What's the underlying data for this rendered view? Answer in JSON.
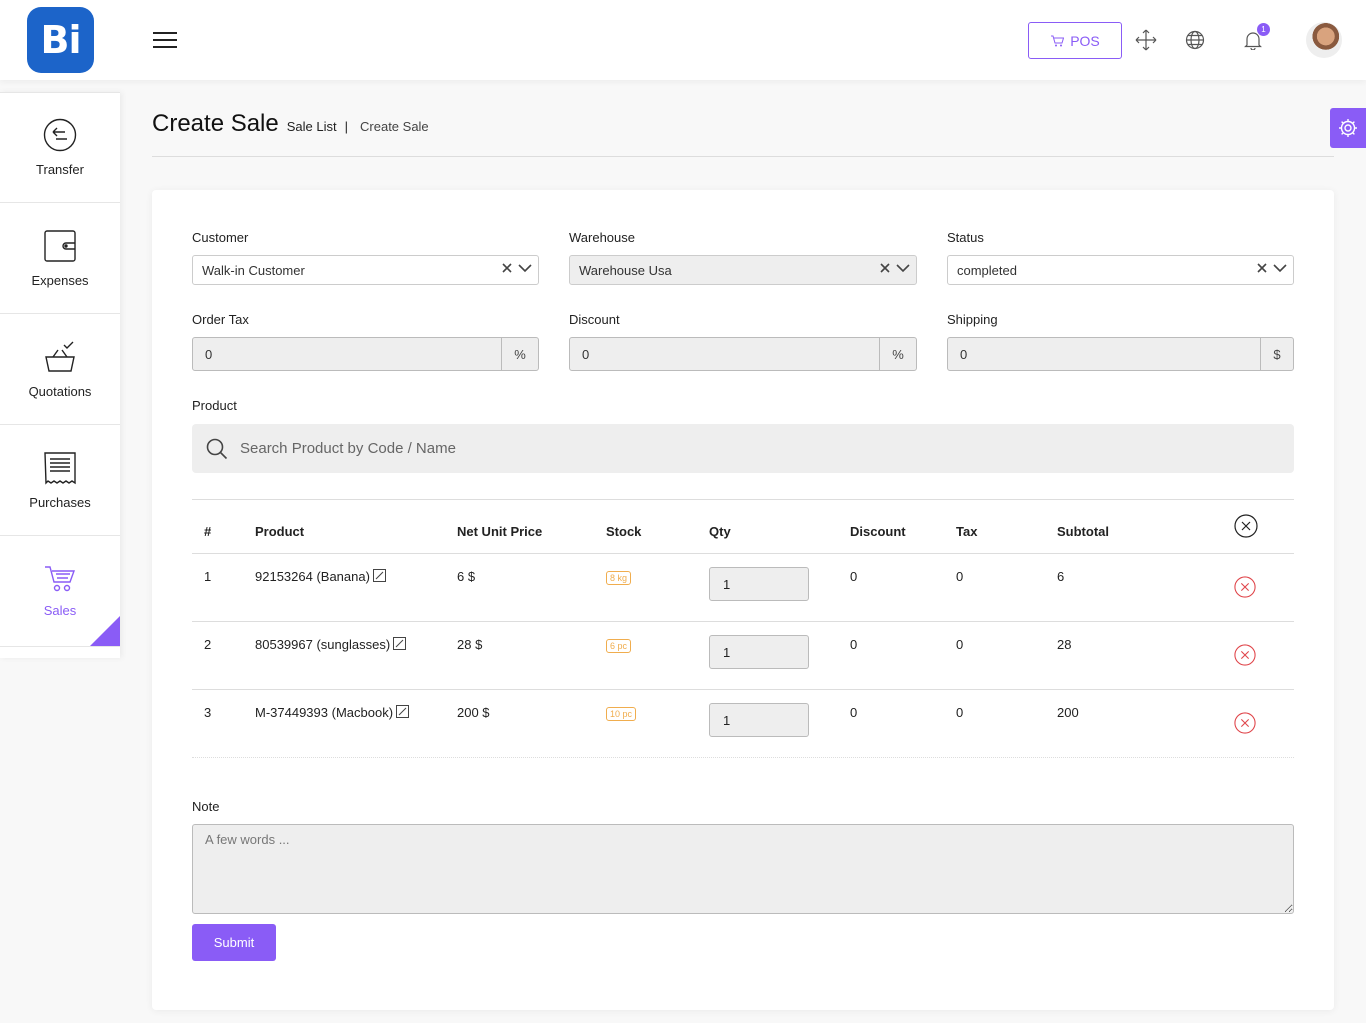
{
  "brand": {
    "logo_text": "Bi",
    "accent_color": "#8a5cf6",
    "logo_color": "#1c64c9"
  },
  "header": {
    "pos_label": "POS",
    "notification_count": "1",
    "icons": [
      "menu-icon",
      "cart-icon",
      "fullscreen-icon",
      "globe-icon",
      "bell-icon",
      "avatar"
    ]
  },
  "sidebar": {
    "items": [
      {
        "label": "Transfer",
        "icon": "transfer-icon"
      },
      {
        "label": "Expenses",
        "icon": "wallet-icon"
      },
      {
        "label": "Quotations",
        "icon": "basket-icon"
      },
      {
        "label": "Purchases",
        "icon": "receipt-icon"
      },
      {
        "label": "Sales",
        "icon": "cart-icon",
        "active": true
      }
    ]
  },
  "page": {
    "title": "Create Sale",
    "breadcrumb": [
      "Sale List",
      "|",
      "Create Sale"
    ]
  },
  "form": {
    "customer": {
      "label": "Customer",
      "value": "Walk-in Customer"
    },
    "warehouse": {
      "label": "Warehouse",
      "value": "Warehouse Usa"
    },
    "status": {
      "label": "Status",
      "value": "completed"
    },
    "order_tax": {
      "label": "Order Tax",
      "value": "0",
      "addon": "%"
    },
    "discount": {
      "label": "Discount",
      "value": "0",
      "addon": "%"
    },
    "shipping": {
      "label": "Shipping",
      "value": "0",
      "addon": "$"
    },
    "product": {
      "label": "Product",
      "placeholder": "Search Product by Code / Name"
    },
    "note": {
      "label": "Note",
      "placeholder": "A few words ..."
    },
    "submit_label": "Submit"
  },
  "table": {
    "columns": [
      "#",
      "Product",
      "Net Unit Price",
      "Stock",
      "Qty",
      "Discount",
      "Tax",
      "Subtotal"
    ],
    "rows": [
      {
        "num": "1",
        "product": "92153264 (Banana)",
        "price": "6 $",
        "stock": "8 kg",
        "qty": "1",
        "discount": "0",
        "tax": "0",
        "subtotal": "6"
      },
      {
        "num": "2",
        "product": "80539967 (sunglasses)",
        "price": "28 $",
        "stock": "6 pc",
        "qty": "1",
        "discount": "0",
        "tax": "0",
        "subtotal": "28"
      },
      {
        "num": "3",
        "product": "M-37449393 (Macbook)",
        "price": "200 $",
        "stock": "10 pc",
        "qty": "1",
        "discount": "0",
        "tax": "0",
        "subtotal": "200"
      }
    ]
  }
}
